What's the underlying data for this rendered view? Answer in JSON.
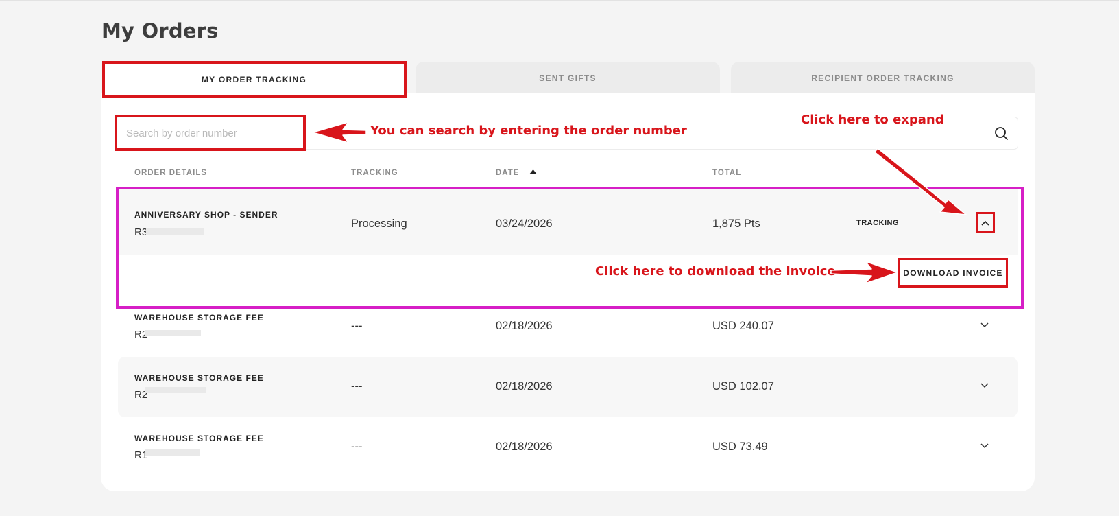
{
  "page": {
    "title": "My Orders"
  },
  "tabs": [
    {
      "label": "MY ORDER TRACKING"
    },
    {
      "label": "SENT GIFTS"
    },
    {
      "label": "RECIPIENT ORDER TRACKING"
    }
  ],
  "search": {
    "placeholder": "Search by order number"
  },
  "table": {
    "headers": {
      "details": "ORDER DETAILS",
      "tracking": "TRACKING",
      "date": "DATE",
      "total": "TOTAL"
    },
    "rows": [
      {
        "title": "ANNIVERSARY SHOP - SENDER",
        "order_prefix": "R3",
        "tracking": "Processing",
        "date": "03/24/2026",
        "total": "1,875 Pts",
        "tracking_link": "TRACKING",
        "download_label": "DOWNLOAD INVOICE"
      },
      {
        "title": "WAREHOUSE STORAGE FEE",
        "order_prefix": "R2",
        "tracking": "---",
        "date": "02/18/2026",
        "total": "USD 240.07"
      },
      {
        "title": "WAREHOUSE STORAGE FEE",
        "order_prefix": "R2",
        "tracking": "---",
        "date": "02/18/2026",
        "total": "USD 102.07"
      },
      {
        "title": "WAREHOUSE STORAGE FEE",
        "order_prefix": "R1",
        "tracking": "---",
        "date": "02/18/2026",
        "total": "USD 73.49"
      }
    ]
  },
  "annotations": {
    "search_note": "You can search by entering the order number",
    "expand_note": "Click here to expand",
    "invoice_note": "Click here to download the invoice"
  },
  "colors": {
    "annotation_red": "#d8151b",
    "highlight_magenta": "#d61fc6",
    "panel_bg": "#ffffff",
    "page_bg": "#f4f4f4"
  }
}
